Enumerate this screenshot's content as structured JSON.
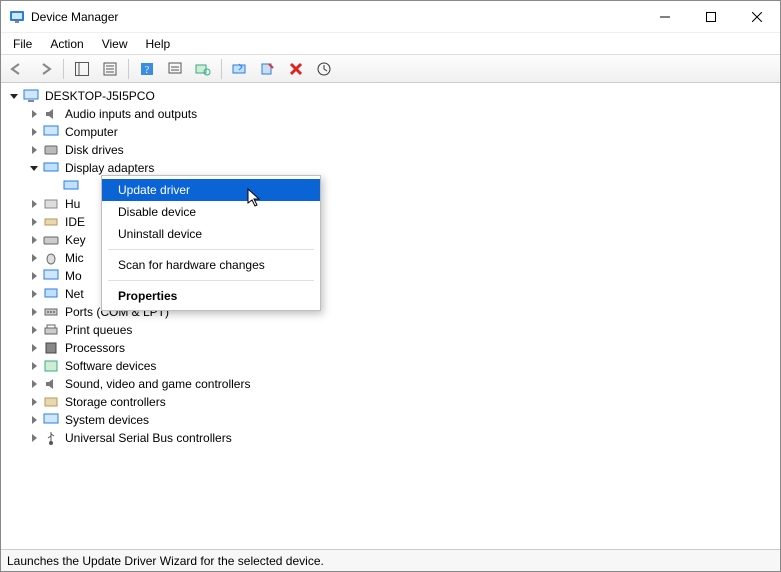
{
  "window": {
    "title": "Device Manager"
  },
  "menubar": {
    "file": "File",
    "action": "Action",
    "view": "View",
    "help": "Help"
  },
  "tree": {
    "root": "DESKTOP-J5I5PCO",
    "categories": {
      "audio": "Audio inputs and outputs",
      "computer": "Computer",
      "disk": "Disk drives",
      "display": "Display adapters",
      "hid": "Hu",
      "ide": "IDE",
      "keyboards": "Key",
      "mice": "Mic",
      "monitors": "Mo",
      "network": "Net",
      "ports": "Ports (COM & LPT)",
      "printq": "Print queues",
      "processors": "Processors",
      "software": "Software devices",
      "sound": "Sound, video and game controllers",
      "storage": "Storage controllers",
      "system": "System devices",
      "usb": "Universal Serial Bus controllers"
    }
  },
  "context_menu": {
    "update": "Update driver",
    "disable": "Disable device",
    "uninstall": "Uninstall device",
    "scan": "Scan for hardware changes",
    "properties": "Properties"
  },
  "statusbar": {
    "text": "Launches the Update Driver Wizard for the selected device."
  }
}
